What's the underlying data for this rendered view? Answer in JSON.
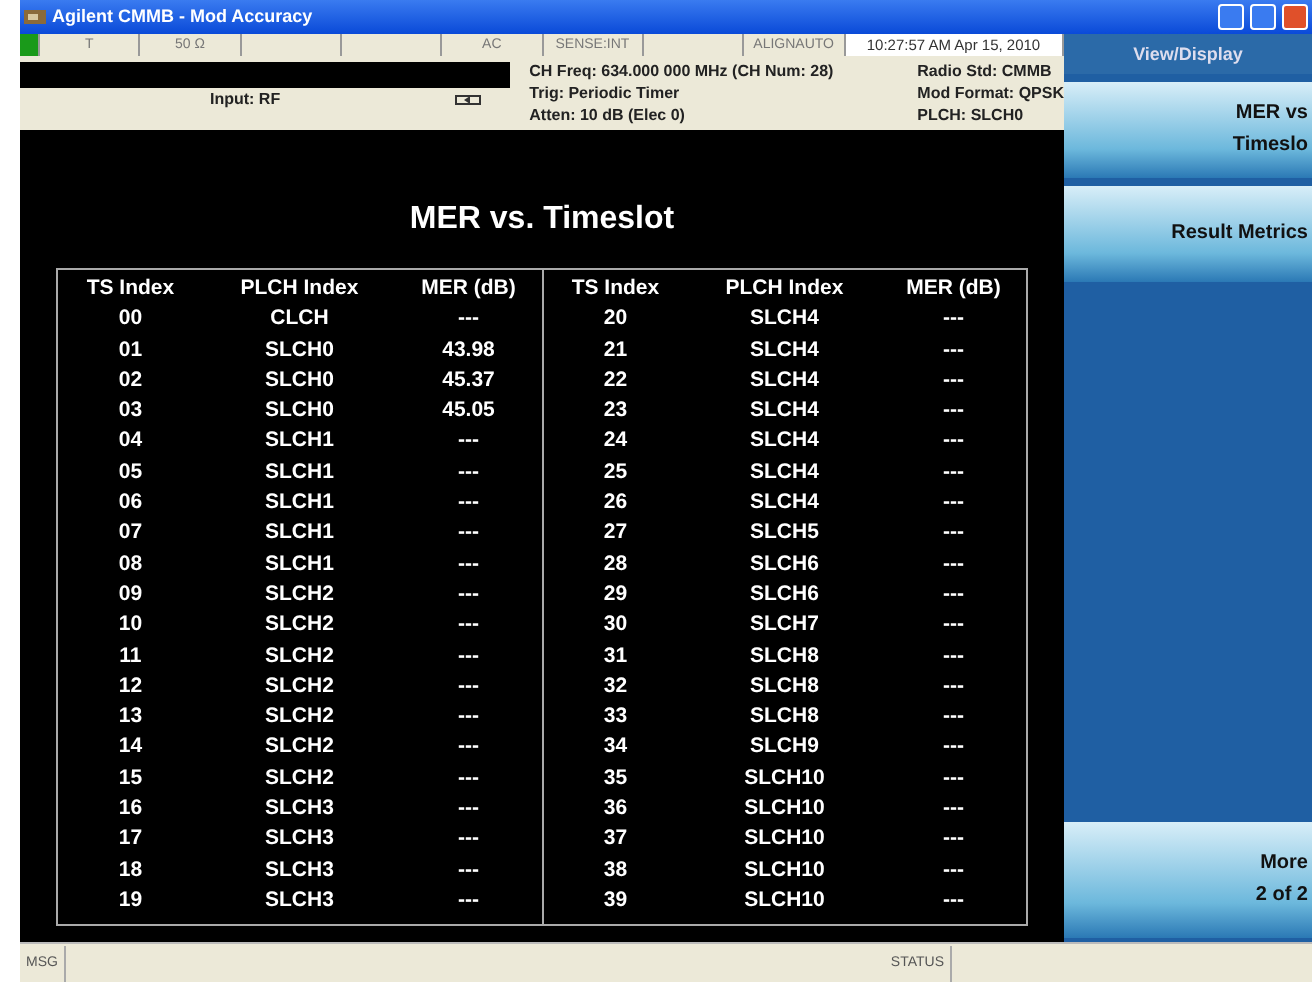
{
  "window": {
    "title": "Agilent CMMB - Mod Accuracy"
  },
  "status_row": [
    "T",
    "50 Ω",
    "AC",
    "SENSE:INT",
    "ALIGNAUTO",
    "10:27:57 AM Apr 15, 2010"
  ],
  "settings": {
    "input": "Input: RF",
    "lines": [
      "CH Freq: 634.000 000 MHz (CH Num: 28)",
      "Trig: Periodic Timer",
      "Atten: 10 dB (Elec 0)"
    ],
    "right_lines": [
      "Radio Std: CMMB",
      "Mod Format: QPSK",
      "PLCH: SLCH0"
    ]
  },
  "result": {
    "title": "MER vs. Timeslot",
    "left_columns": [
      "TS Index",
      "PLCH Index",
      "MER (dB)"
    ],
    "right_columns": [
      "TS Index",
      "PLCH Index",
      "MER (dB)"
    ],
    "left_rows": [
      [
        "00",
        "CLCH",
        "---"
      ],
      [
        "01",
        "SLCH0",
        "43.98"
      ],
      [
        "02",
        "SLCH0",
        "45.37"
      ],
      [
        "03",
        "SLCH0",
        "45.05"
      ],
      [
        "04",
        "SLCH1",
        "---"
      ],
      [
        "05",
        "SLCH1",
        "---"
      ],
      [
        "06",
        "SLCH1",
        "---"
      ],
      [
        "07",
        "SLCH1",
        "---"
      ],
      [
        "08",
        "SLCH1",
        "---"
      ],
      [
        "09",
        "SLCH2",
        "---"
      ],
      [
        "10",
        "SLCH2",
        "---"
      ],
      [
        "11",
        "SLCH2",
        "---"
      ],
      [
        "12",
        "SLCH2",
        "---"
      ],
      [
        "13",
        "SLCH2",
        "---"
      ],
      [
        "14",
        "SLCH2",
        "---"
      ],
      [
        "15",
        "SLCH2",
        "---"
      ],
      [
        "16",
        "SLCH3",
        "---"
      ],
      [
        "17",
        "SLCH3",
        "---"
      ],
      [
        "18",
        "SLCH3",
        "---"
      ],
      [
        "19",
        "SLCH3",
        "---"
      ]
    ],
    "right_rows": [
      [
        "20",
        "SLCH4",
        "---"
      ],
      [
        "21",
        "SLCH4",
        "---"
      ],
      [
        "22",
        "SLCH4",
        "---"
      ],
      [
        "23",
        "SLCH4",
        "---"
      ],
      [
        "24",
        "SLCH4",
        "---"
      ],
      [
        "25",
        "SLCH4",
        "---"
      ],
      [
        "26",
        "SLCH4",
        "---"
      ],
      [
        "27",
        "SLCH5",
        "---"
      ],
      [
        "28",
        "SLCH6",
        "---"
      ],
      [
        "29",
        "SLCH6",
        "---"
      ],
      [
        "30",
        "SLCH7",
        "---"
      ],
      [
        "31",
        "SLCH8",
        "---"
      ],
      [
        "32",
        "SLCH8",
        "---"
      ],
      [
        "33",
        "SLCH8",
        "---"
      ],
      [
        "34",
        "SLCH9",
        "---"
      ],
      [
        "35",
        "SLCH10",
        "---"
      ],
      [
        "36",
        "SLCH10",
        "---"
      ],
      [
        "37",
        "SLCH10",
        "---"
      ],
      [
        "38",
        "SLCH10",
        "---"
      ],
      [
        "39",
        "SLCH10",
        "---"
      ]
    ]
  },
  "softkeys": {
    "menu": "View/Display",
    "keys": [
      {
        "lines": [
          "MER vs",
          "Timeslo"
        ]
      },
      {
        "lines": [
          "Result Metrics"
        ]
      }
    ],
    "more": [
      "More",
      "2 of 2"
    ]
  },
  "status_bar": {
    "msg": "MSG",
    "status": "STATUS"
  }
}
